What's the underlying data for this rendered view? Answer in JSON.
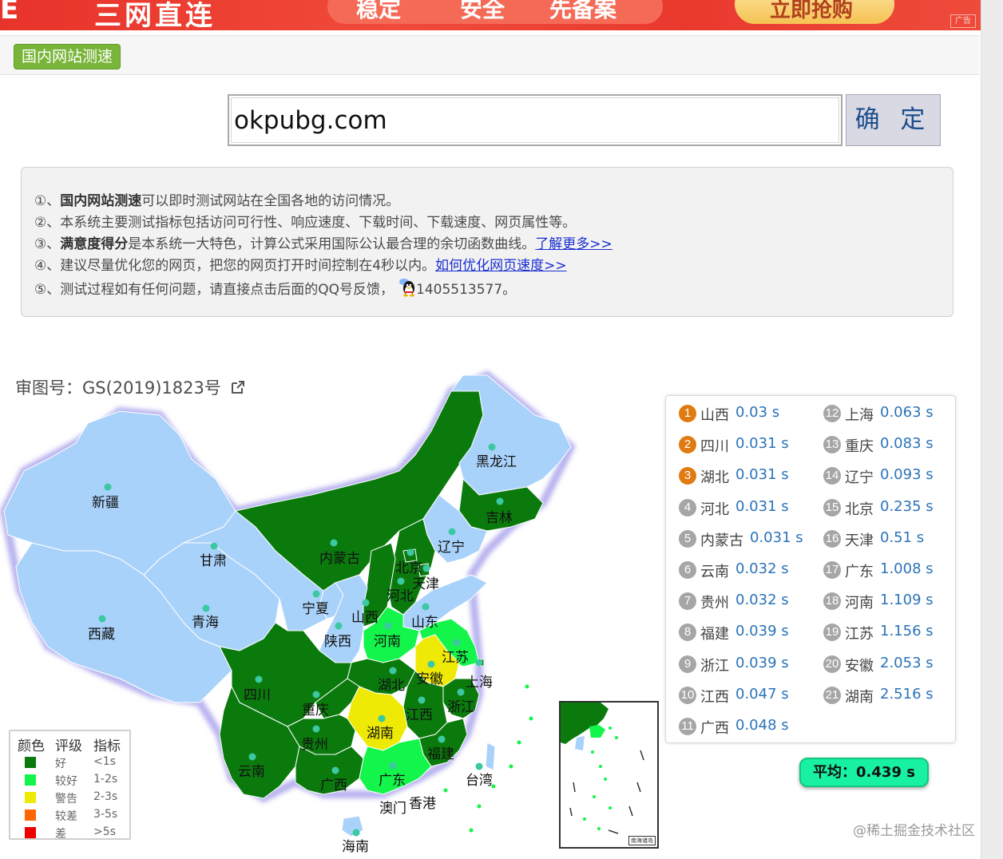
{
  "ad": {
    "left_text": "E",
    "main_text": "三网直连",
    "pill_words": [
      "稳定",
      "安全",
      "先备案"
    ],
    "cta": "立即抢购",
    "tag": "广告"
  },
  "tab": {
    "label": "国内网站测速"
  },
  "search": {
    "value": "okpubg.com",
    "button": "确 定"
  },
  "info": {
    "l1_num": "①、",
    "l1_bold": "国内网站测速",
    "l1_rest": "可以即时测试网站在全国各地的访问情况。",
    "l2_num": "②、",
    "l2_rest": "本系统主要测试指标包括访问可行性、响应速度、下载时间、下载速度、网页属性等。",
    "l3_num": "③、",
    "l3_bold": "满意度得分",
    "l3_rest": "是本系统一大特色，计算公式采用国际公认最合理的余切函数曲线。",
    "l3_link": "了解更多>>",
    "l4_num": "④、",
    "l4_rest": "建议尽量优化您的网页，把您的网页打开时间控制在4秒以内。",
    "l4_link": "如何优化网页速度>>",
    "l5_num": "⑤、",
    "l5_rest": "测试过程如有任何问题，请直接点击后面的QQ号反馈，",
    "l5_qq": "1405513577。"
  },
  "map": {
    "code": "审图号：GS(2019)1823号",
    "provinces": {
      "xinjiang": "新疆",
      "xizang": "西藏",
      "qinghai": "青海",
      "gansu": "甘肃",
      "neimenggu": "内蒙古",
      "heilongjiang": "黑龙江",
      "jilin": "吉林",
      "liaoning": "辽宁",
      "beijing": "北京",
      "tianjin": "天津",
      "hebei": "河北",
      "shanxi": "山西",
      "ningxia": "宁夏",
      "shaanxi": "陕西",
      "shandong": "山东",
      "henan": "河南",
      "jiangsu": "江苏",
      "shanghai": "上海",
      "anhui": "安徽",
      "hubei": "湖北",
      "sichuan": "四川",
      "chongqing": "重庆",
      "zhejiang": "浙江",
      "jiangxi": "江西",
      "hunan": "湖南",
      "guizhou": "贵州",
      "fujian": "福建",
      "yunnan": "云南",
      "guangxi": "广西",
      "guangdong": "广东",
      "taiwan": "台湾",
      "aomen": "澳门",
      "xianggang": "香港",
      "hainan": "海南"
    },
    "colors": {
      "nodata": "#a9d2fb",
      "good": "#0b7a0d",
      "ok": "#13f54a",
      "warn": "#eeea05",
      "bad": "#ff6600",
      "worst": "#ee0000"
    }
  },
  "legend": {
    "headers": [
      "颜色",
      "评级",
      "指标"
    ],
    "rows": [
      {
        "level": "好",
        "range": "<1s",
        "color": "#0b7a0d"
      },
      {
        "level": "较好",
        "range": "1-2s",
        "color": "#13f54a"
      },
      {
        "level": "警告",
        "range": "2-3s",
        "color": "#eeea05"
      },
      {
        "level": "较差",
        "range": "3-5s",
        "color": "#ff6600"
      },
      {
        "level": "差",
        "range": ">5s",
        "color": "#ee0000"
      }
    ]
  },
  "ranking": [
    {
      "rank": "1",
      "province": "山西",
      "time": "0.03 s"
    },
    {
      "rank": "2",
      "province": "四川",
      "time": "0.031 s"
    },
    {
      "rank": "3",
      "province": "湖北",
      "time": "0.031 s"
    },
    {
      "rank": "4",
      "province": "河北",
      "time": "0.031 s"
    },
    {
      "rank": "5",
      "province": "内蒙古",
      "time": "0.031 s"
    },
    {
      "rank": "6",
      "province": "云南",
      "time": "0.032 s"
    },
    {
      "rank": "7",
      "province": "贵州",
      "time": "0.032 s"
    },
    {
      "rank": "8",
      "province": "福建",
      "time": "0.039 s"
    },
    {
      "rank": "9",
      "province": "浙江",
      "time": "0.039 s"
    },
    {
      "rank": "10",
      "province": "江西",
      "time": "0.047 s"
    },
    {
      "rank": "11",
      "province": "广西",
      "time": "0.048 s"
    },
    {
      "rank": "12",
      "province": "上海",
      "time": "0.063 s"
    },
    {
      "rank": "13",
      "province": "重庆",
      "time": "0.083 s"
    },
    {
      "rank": "14",
      "province": "辽宁",
      "time": "0.093 s"
    },
    {
      "rank": "15",
      "province": "北京",
      "time": "0.235 s"
    },
    {
      "rank": "16",
      "province": "天津",
      "time": "0.51 s"
    },
    {
      "rank": "17",
      "province": "广东",
      "time": "1.008 s"
    },
    {
      "rank": "18",
      "province": "河南",
      "time": "1.109 s"
    },
    {
      "rank": "19",
      "province": "江苏",
      "time": "1.156 s"
    },
    {
      "rank": "20",
      "province": "安徽",
      "time": "2.053 s"
    },
    {
      "rank": "21",
      "province": "湖南",
      "time": "2.516 s"
    }
  ],
  "ranking_colors": {
    "top": "#e07b12",
    "rest": "#a6a6a6",
    "time": "#2b73b8"
  },
  "average": {
    "label": "平均：0.439 s"
  },
  "watermark": "@稀土掘金技术社区"
}
